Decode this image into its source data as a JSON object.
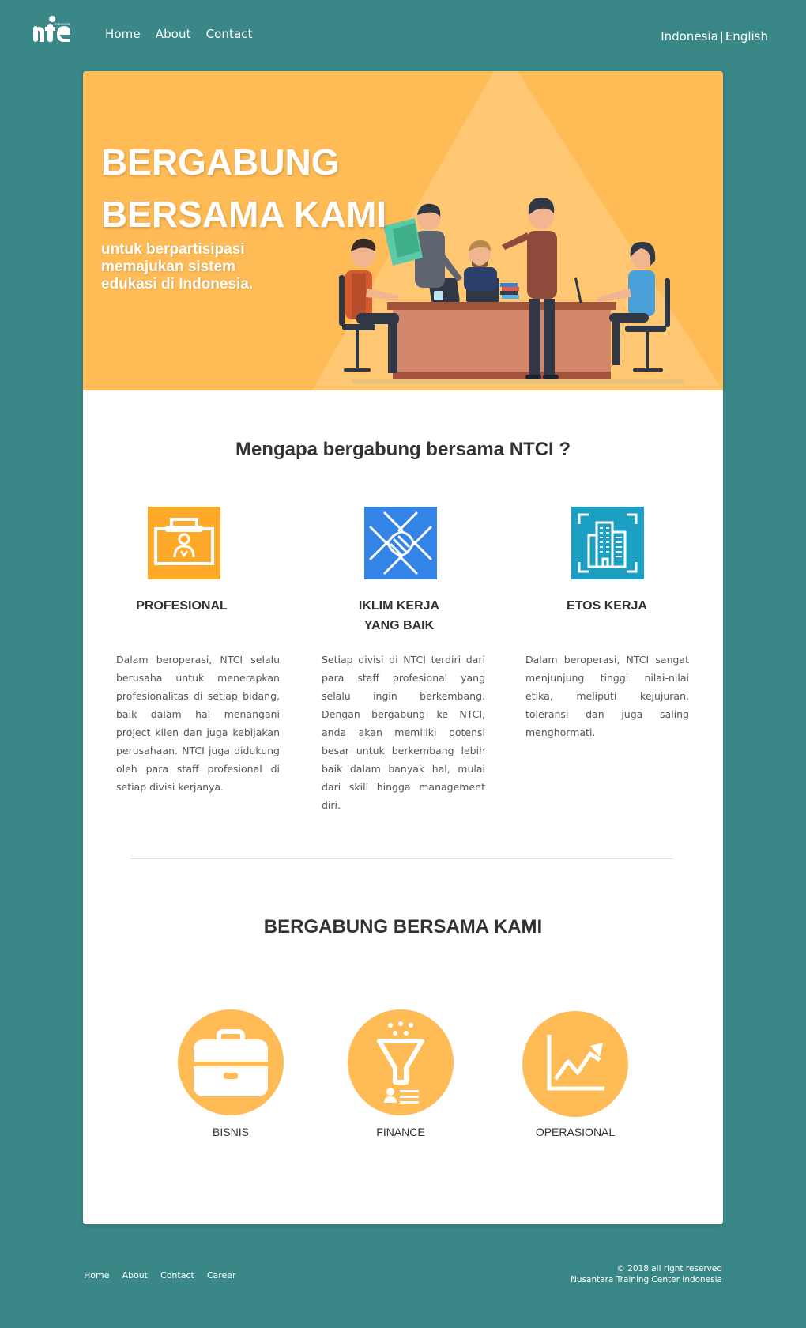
{
  "header": {
    "logo_text": "nte",
    "logo_small": "Indonesia",
    "nav": [
      "Home",
      "About",
      "Contact"
    ],
    "lang": {
      "indonesia": "Indonesia",
      "separator": "|",
      "english": "English"
    }
  },
  "hero": {
    "title_line1": "BERGABUNG",
    "title_line2": "BERSAMA KAMI",
    "subtitle": "untuk berpartisipasi memajukan sistem edukasi di Indonesia."
  },
  "why": {
    "title": "Mengapa bergabung bersama NTCI ?",
    "features": [
      {
        "title": "PROFESIONAL",
        "icon": "briefcase-profile-icon",
        "color": "#ffa929",
        "text": "Dalam beroperasi, NTCI selalu berusaha untuk menerapkan profesionalitas di setiap bidang, baik dalam hal menangani project klien dan juga kebijakan perusahaan. NTCI juga didukung oleh para staff profesional di setiap divisi kerjanya."
      },
      {
        "title_line1": "IKLIM KERJA",
        "title_line2": "YANG BAIK",
        "icon": "handshake-icon",
        "color": "#3484e8",
        "text": "Setiap divisi di NTCI terdiri dari para staff profesional yang selalu ingin berkembang. Dengan bergabung ke NTCI, anda akan memiliki potensi besar untuk berkembang lebih baik dalam banyak hal, mulai dari skill hingga management diri."
      },
      {
        "title": "ETOS KERJA",
        "icon": "building-icon",
        "color": "#1ba0c4",
        "text": "Dalam beroperasi, NTCI sangat menjunjung tinggi nilai-nilai etika, meliputi kejujuran, toleransi dan juga saling menghormati."
      }
    ]
  },
  "join": {
    "title": "BERGABUNG BERSAMA KAMI",
    "items": [
      {
        "label": "BISNIS",
        "icon": "briefcase-icon"
      },
      {
        "label": "FINANCE",
        "icon": "funnel-icon"
      },
      {
        "label": "OPERASIONAL",
        "icon": "growth-chart-icon"
      }
    ]
  },
  "footer": {
    "nav": [
      "Home",
      "About",
      "Contact",
      "Career"
    ],
    "copyright": "© 2018  all right reserved",
    "company": "Nusantara Training Center Indonesia"
  },
  "colors": {
    "background": "#3a8788",
    "hero": "#ffbb55",
    "accent_circle": "#ffbb55"
  }
}
